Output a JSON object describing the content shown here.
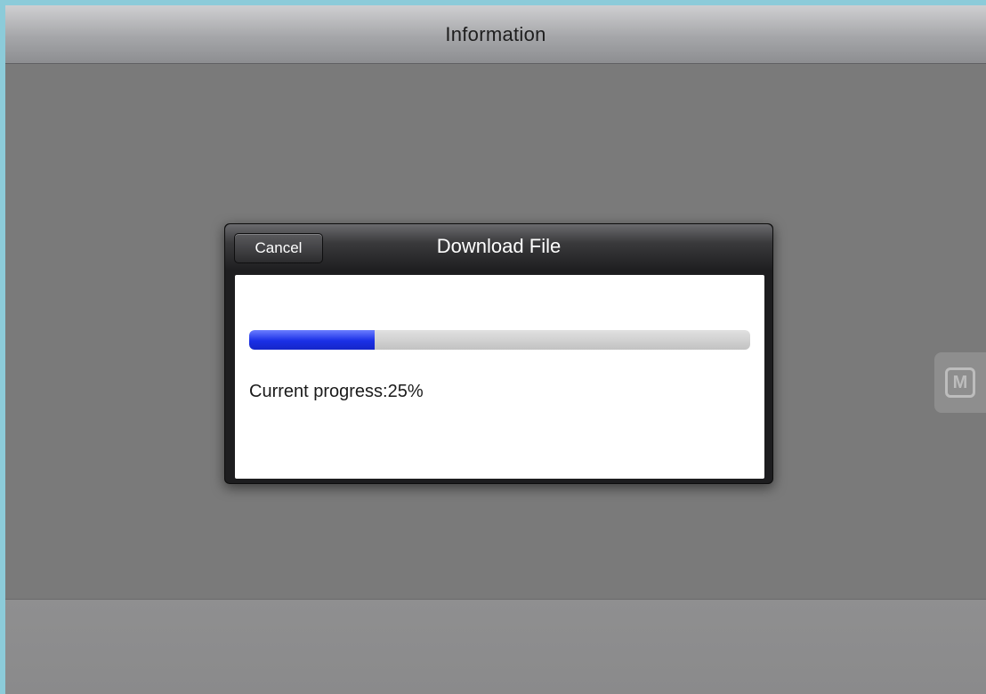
{
  "window": {
    "title": "Information"
  },
  "side_tab": {
    "label": "M",
    "icon": "m-icon"
  },
  "dialog": {
    "title": "Download File",
    "cancel_label": "Cancel",
    "progress_text": "Current progress:25%",
    "progress_value": 0.25
  },
  "colors": {
    "progress_fill": "#1a2fe6",
    "progress_track": "#c8c8c8",
    "page_background": "#7a7a7a"
  }
}
